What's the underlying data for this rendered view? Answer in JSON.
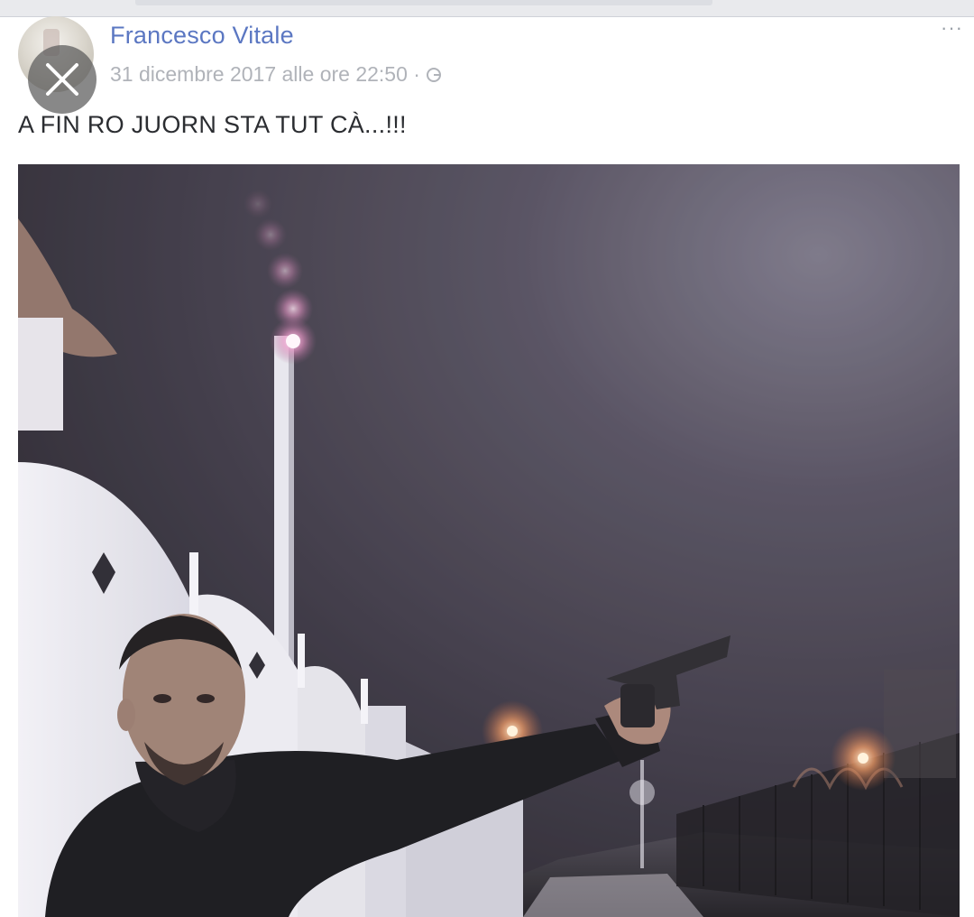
{
  "post": {
    "author": "Francesco Vitale",
    "timestamp": "31 dicembre 2017 alle ore 22:50",
    "privacy_separator": "·",
    "privacy_icon": "globe-icon",
    "text": "A FIN RO JUORN STA TUT CÀ...!!!",
    "more_label": "···"
  },
  "overlay": {
    "close_icon": "close-icon"
  },
  "colors": {
    "author_link": "#5b77c2",
    "meta_text": "#b0b3b9",
    "post_text": "#2b2d31"
  }
}
